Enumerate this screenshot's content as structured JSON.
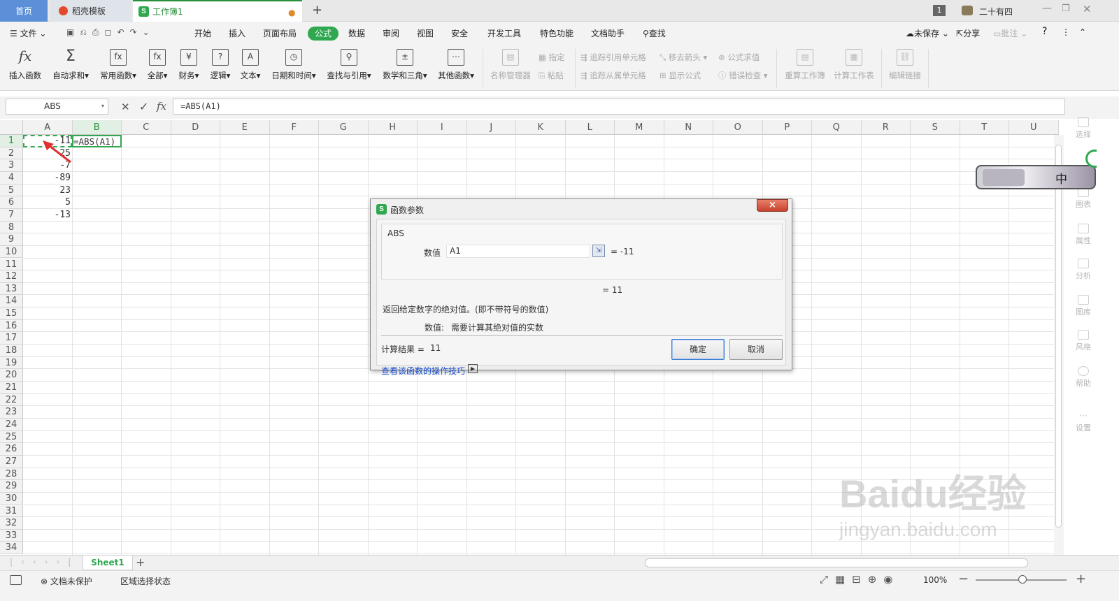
{
  "tabs": {
    "home": "首页",
    "templates": "稻壳模板",
    "workbook": "工作簿1",
    "add": "+"
  },
  "title_right": {
    "badge": "1",
    "user": "二十有四"
  },
  "menu": {
    "file": "文件",
    "items": [
      "开始",
      "插入",
      "页面布局",
      "公式",
      "数据",
      "审阅",
      "视图",
      "安全",
      "开发工具",
      "特色功能",
      "文档助手"
    ],
    "search": "查找",
    "unsaved": "未保存",
    "share": "分享",
    "comment": "批注",
    "help": "?"
  },
  "ribbon": {
    "buttons": [
      "插入函数",
      "自动求和",
      "常用函数",
      "全部",
      "财务",
      "逻辑",
      "文本",
      "日期和时间",
      "查找与引用",
      "数学和三角",
      "其他函数",
      "名称管理器"
    ],
    "small": [
      "指定",
      "粘贴",
      "追踪引用单元格",
      "追踪从属单元格",
      "移去箭头",
      "显示公式",
      "公式求值",
      "错误检查"
    ],
    "right": [
      "重算工作簿",
      "计算工作表",
      "编辑链接"
    ]
  },
  "formula_bar": {
    "name_box": "ABS",
    "fx": "fx",
    "formula": "=ABS(A1)"
  },
  "columns": [
    "A",
    "B",
    "C",
    "D",
    "E",
    "F",
    "G",
    "H",
    "I",
    "J",
    "K",
    "L",
    "M",
    "N",
    "O",
    "P",
    "Q",
    "R",
    "S",
    "T",
    "U"
  ],
  "rows": [
    "1",
    "2",
    "3",
    "4",
    "5",
    "6",
    "7",
    "8",
    "9",
    "10",
    "11",
    "12",
    "13",
    "14",
    "15",
    "16",
    "17",
    "18",
    "19",
    "20",
    "21",
    "22",
    "23",
    "24",
    "25",
    "26",
    "27",
    "28",
    "29",
    "30",
    "31",
    "32",
    "33",
    "34"
  ],
  "cells": {
    "A": [
      "-11",
      "25",
      "-7",
      "-89",
      "23",
      "5",
      "-13"
    ],
    "B1": "=ABS(A1)"
  },
  "dialog": {
    "title": "函数参数",
    "function_name": "ABS",
    "arg_label": "数值",
    "arg_value": "A1",
    "arg_result": "= -11",
    "result": "= 11",
    "description": "返回给定数字的绝对值。(即不带符号的数值)",
    "arg_desc_label": "数值:",
    "arg_desc": "需要计算其绝对值的实数",
    "calc_label": "计算结果 =",
    "calc_value": "11",
    "help_link": "查看该函数的操作技巧",
    "ok": "确定",
    "cancel": "取消",
    "close": "×"
  },
  "side_panel": [
    "选择",
    "图表",
    "属性",
    "分析",
    "图库",
    "风格",
    "帮助",
    "设置"
  ],
  "ime": "中",
  "sheet": {
    "name": "Sheet1",
    "add": "+"
  },
  "status": {
    "protect": "文档未保护",
    "mode": "区域选择状态",
    "zoom": "100%"
  },
  "watermark": {
    "line1": "Baidu经验",
    "line2": "jingyan.baidu.com"
  },
  "colors": {
    "accent": "#2fa84f",
    "home_tab": "#5b8fd8",
    "link": "#1a4fcf",
    "arrow": "#e03030"
  }
}
